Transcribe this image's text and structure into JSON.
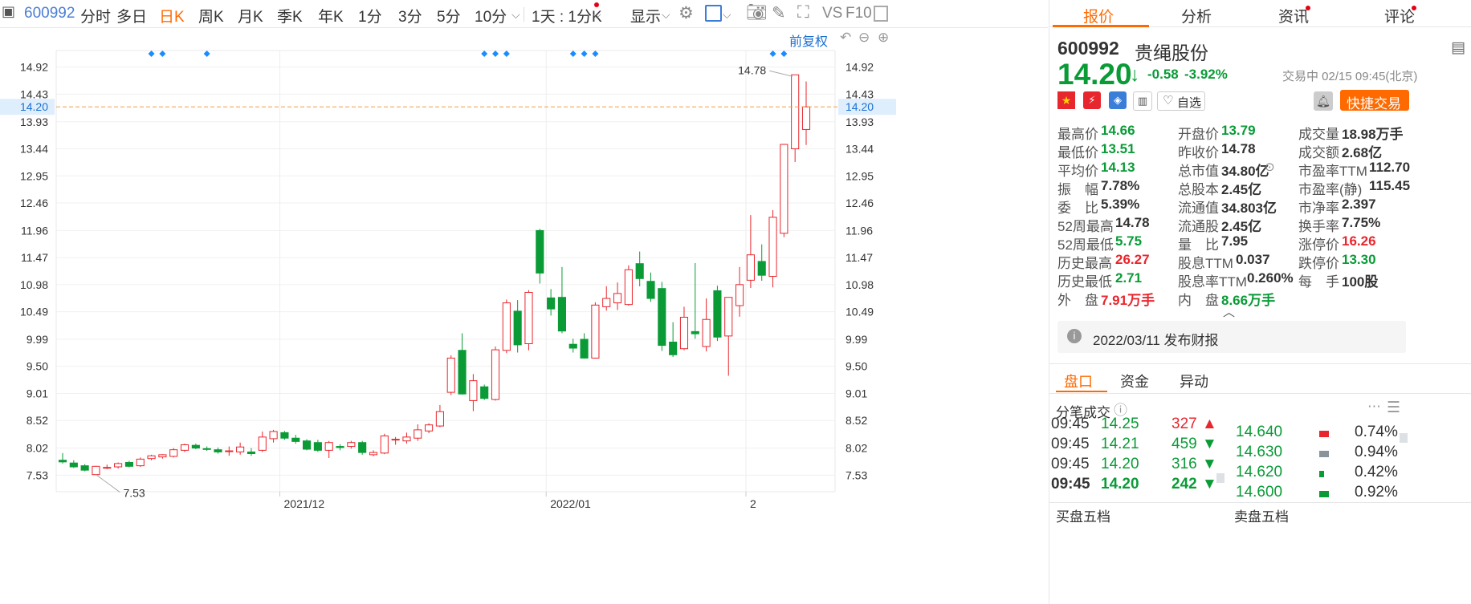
{
  "toolbar": {
    "code": "600992",
    "tabs": [
      "分时",
      "多日",
      "日K",
      "周K",
      "月K",
      "季K",
      "年K",
      "1分",
      "3分",
      "5分",
      "10分"
    ],
    "active_tab": "日K",
    "period_select": "1天 : 1分K",
    "display_label": "显示",
    "vs_label": "VS",
    "f10_label": "F10",
    "restore_label": "前复权"
  },
  "chart": {
    "y_ticks": [
      "14.92",
      "14.43",
      "13.93",
      "13.44",
      "12.95",
      "12.46",
      "11.96",
      "11.47",
      "10.98",
      "10.49",
      "9.99",
      "9.50",
      "9.01",
      "8.52",
      "8.02",
      "7.53"
    ],
    "current_price_tag": "14.20",
    "x_labels": [
      "2021/12",
      "2022/01",
      "2"
    ],
    "max_label": "14.78",
    "min_label": "7.53"
  },
  "chart_data": {
    "type": "candlestick",
    "title": "",
    "ylim": [
      7.23,
      15.22
    ],
    "y_tick_values": [
      14.92,
      14.43,
      13.93,
      13.44,
      12.95,
      12.46,
      11.96,
      11.47,
      10.98,
      10.49,
      9.99,
      9.5,
      9.01,
      8.52,
      8.02,
      7.53
    ],
    "current_price": 14.2,
    "candles": [
      {
        "o": 7.8,
        "h": 7.93,
        "l": 7.74,
        "c": 7.77
      },
      {
        "o": 7.75,
        "h": 7.8,
        "l": 7.66,
        "c": 7.68
      },
      {
        "o": 7.7,
        "h": 7.73,
        "l": 7.6,
        "c": 7.62
      },
      {
        "o": 7.54,
        "h": 7.7,
        "l": 7.53,
        "c": 7.69
      },
      {
        "o": 7.66,
        "h": 7.72,
        "l": 7.64,
        "c": 7.67
      },
      {
        "o": 7.68,
        "h": 7.76,
        "l": 7.65,
        "c": 7.74
      },
      {
        "o": 7.76,
        "h": 7.79,
        "l": 7.67,
        "c": 7.69
      },
      {
        "o": 7.7,
        "h": 7.85,
        "l": 7.68,
        "c": 7.82
      },
      {
        "o": 7.83,
        "h": 7.9,
        "l": 7.8,
        "c": 7.88
      },
      {
        "o": 7.86,
        "h": 7.91,
        "l": 7.83,
        "c": 7.9
      },
      {
        "o": 7.87,
        "h": 8.02,
        "l": 7.85,
        "c": 7.99
      },
      {
        "o": 7.98,
        "h": 8.1,
        "l": 7.95,
        "c": 8.08
      },
      {
        "o": 8.07,
        "h": 8.1,
        "l": 8.0,
        "c": 8.02
      },
      {
        "o": 8.01,
        "h": 8.05,
        "l": 7.97,
        "c": 8.0
      },
      {
        "o": 7.99,
        "h": 8.03,
        "l": 7.92,
        "c": 7.95
      },
      {
        "o": 7.96,
        "h": 8.05,
        "l": 7.88,
        "c": 7.97
      },
      {
        "o": 7.95,
        "h": 8.12,
        "l": 7.9,
        "c": 8.04
      },
      {
        "o": 7.95,
        "h": 8.02,
        "l": 7.88,
        "c": 7.92
      },
      {
        "o": 7.98,
        "h": 8.32,
        "l": 7.95,
        "c": 8.22
      },
      {
        "o": 8.19,
        "h": 8.35,
        "l": 8.12,
        "c": 8.32
      },
      {
        "o": 8.3,
        "h": 8.33,
        "l": 8.17,
        "c": 8.2
      },
      {
        "o": 8.2,
        "h": 8.26,
        "l": 8.1,
        "c": 8.14
      },
      {
        "o": 8.15,
        "h": 8.18,
        "l": 7.98,
        "c": 8.0
      },
      {
        "o": 8.12,
        "h": 8.17,
        "l": 7.95,
        "c": 7.98
      },
      {
        "o": 7.98,
        "h": 8.15,
        "l": 7.84,
        "c": 8.12
      },
      {
        "o": 8.05,
        "h": 8.09,
        "l": 7.98,
        "c": 8.03
      },
      {
        "o": 8.05,
        "h": 8.15,
        "l": 8.01,
        "c": 8.12
      },
      {
        "o": 8.12,
        "h": 8.15,
        "l": 7.9,
        "c": 7.94
      },
      {
        "o": 7.9,
        "h": 7.98,
        "l": 7.87,
        "c": 7.94
      },
      {
        "o": 7.93,
        "h": 8.28,
        "l": 7.91,
        "c": 8.24
      },
      {
        "o": 8.18,
        "h": 8.22,
        "l": 8.08,
        "c": 8.18
      },
      {
        "o": 8.15,
        "h": 8.3,
        "l": 8.1,
        "c": 8.22
      },
      {
        "o": 8.2,
        "h": 8.45,
        "l": 8.15,
        "c": 8.35
      },
      {
        "o": 8.33,
        "h": 8.47,
        "l": 8.29,
        "c": 8.44
      },
      {
        "o": 8.42,
        "h": 8.8,
        "l": 8.4,
        "c": 8.68
      },
      {
        "o": 9.03,
        "h": 9.7,
        "l": 8.98,
        "c": 9.65
      },
      {
        "o": 9.79,
        "h": 10.1,
        "l": 8.99,
        "c": 9.0
      },
      {
        "o": 8.88,
        "h": 9.36,
        "l": 8.69,
        "c": 9.24
      },
      {
        "o": 9.13,
        "h": 9.17,
        "l": 8.89,
        "c": 8.92
      },
      {
        "o": 8.9,
        "h": 9.86,
        "l": 8.88,
        "c": 9.8
      },
      {
        "o": 9.79,
        "h": 10.71,
        "l": 9.74,
        "c": 10.65
      },
      {
        "o": 10.5,
        "h": 10.7,
        "l": 9.75,
        "c": 9.89
      },
      {
        "o": 9.91,
        "h": 10.88,
        "l": 9.79,
        "c": 10.84
      },
      {
        "o": 11.96,
        "h": 11.99,
        "l": 11.0,
        "c": 11.19
      },
      {
        "o": 10.74,
        "h": 10.9,
        "l": 10.42,
        "c": 10.54
      },
      {
        "o": 10.75,
        "h": 11.3,
        "l": 10.1,
        "c": 10.14
      },
      {
        "o": 9.9,
        "h": 10.0,
        "l": 9.75,
        "c": 9.83
      },
      {
        "o": 9.99,
        "h": 10.1,
        "l": 9.64,
        "c": 9.65
      },
      {
        "o": 9.65,
        "h": 10.66,
        "l": 9.64,
        "c": 10.61
      },
      {
        "o": 10.58,
        "h": 10.95,
        "l": 10.51,
        "c": 10.73
      },
      {
        "o": 10.65,
        "h": 11.02,
        "l": 10.52,
        "c": 10.82
      },
      {
        "o": 10.62,
        "h": 11.33,
        "l": 10.6,
        "c": 11.25
      },
      {
        "o": 11.36,
        "h": 11.58,
        "l": 10.95,
        "c": 11.09
      },
      {
        "o": 11.04,
        "h": 11.2,
        "l": 10.67,
        "c": 10.73
      },
      {
        "o": 10.91,
        "h": 11.03,
        "l": 9.78,
        "c": 9.88
      },
      {
        "o": 9.94,
        "h": 10.3,
        "l": 9.67,
        "c": 9.71
      },
      {
        "o": 9.82,
        "h": 10.58,
        "l": 9.79,
        "c": 10.39
      },
      {
        "o": 10.13,
        "h": 11.37,
        "l": 10.0,
        "c": 10.09
      },
      {
        "o": 9.86,
        "h": 10.73,
        "l": 9.77,
        "c": 10.35
      },
      {
        "o": 10.87,
        "h": 10.96,
        "l": 9.96,
        "c": 10.03
      },
      {
        "o": 10.05,
        "h": 10.3,
        "l": 9.33,
        "c": 10.75
      },
      {
        "o": 10.6,
        "h": 11.3,
        "l": 10.4,
        "c": 10.98
      },
      {
        "o": 11.06,
        "h": 12.24,
        "l": 10.92,
        "c": 11.52
      },
      {
        "o": 11.4,
        "h": 11.71,
        "l": 11.05,
        "c": 11.15
      },
      {
        "o": 11.13,
        "h": 12.33,
        "l": 10.93,
        "c": 12.2
      },
      {
        "o": 11.91,
        "h": 13.53,
        "l": 11.84,
        "c": 13.52
      },
      {
        "o": 13.44,
        "h": 14.78,
        "l": 13.2,
        "c": 14.78
      },
      {
        "o": 13.79,
        "h": 14.66,
        "l": 13.51,
        "c": 14.2
      }
    ]
  },
  "quote": {
    "code": "600992",
    "name": "贵绳股份",
    "price": "14.20",
    "arrow": "↓",
    "change": "-0.58",
    "change_pct": "-3.92%",
    "status": "交易中 02/15 09:45(北京)",
    "watch_label": "自选",
    "trade_label": "快捷交易",
    "fields": [
      [
        {
          "k": "最高价",
          "v": "14.66",
          "c": "down"
        },
        {
          "k": "开盘价",
          "v": "13.79",
          "c": "down"
        },
        {
          "k": "成交量",
          "v": "18.98万手",
          "c": ""
        }
      ],
      [
        {
          "k": "最低价",
          "v": "13.51",
          "c": "down"
        },
        {
          "k": "昨收价",
          "v": "14.78",
          "c": ""
        },
        {
          "k": "成交额",
          "v": "2.68亿",
          "c": ""
        }
      ],
      [
        {
          "k": "平均价",
          "v": "14.13",
          "c": "down"
        },
        {
          "k": "总市值",
          "v": "34.80亿",
          "c": ""
        },
        {
          "k": "市盈率TTM",
          "v": "112.70",
          "c": ""
        }
      ],
      [
        {
          "k": "振　幅",
          "v": "7.78%",
          "c": ""
        },
        {
          "k": "总股本",
          "v": "2.45亿",
          "c": ""
        },
        {
          "k": "市盈率(静)",
          "v": "115.45",
          "c": ""
        }
      ],
      [
        {
          "k": "委　比",
          "v": "5.39%",
          "c": ""
        },
        {
          "k": "流通值",
          "v": "34.803亿",
          "c": ""
        },
        {
          "k": "市净率",
          "v": "2.397",
          "c": ""
        }
      ],
      [
        {
          "k": "52周最高",
          "v": "14.78",
          "c": ""
        },
        {
          "k": "流通股",
          "v": "2.45亿",
          "c": ""
        },
        {
          "k": "换手率",
          "v": "7.75%",
          "c": ""
        }
      ],
      [
        {
          "k": "52周最低",
          "v": "5.75",
          "c": "down"
        },
        {
          "k": "量　比",
          "v": "7.95",
          "c": ""
        },
        {
          "k": "涨停价",
          "v": "16.26",
          "c": "up"
        }
      ],
      [
        {
          "k": "历史最高",
          "v": "26.27",
          "c": "up"
        },
        {
          "k": "股息TTM",
          "v": "0.037",
          "c": ""
        },
        {
          "k": "跌停价",
          "v": "13.30",
          "c": "down"
        }
      ],
      [
        {
          "k": "历史最低",
          "v": "2.71",
          "c": "down"
        },
        {
          "k": "股息率TTM",
          "v": "0.260%",
          "c": ""
        },
        {
          "k": "每　手",
          "v": "100股",
          "c": ""
        }
      ],
      [
        {
          "k": "外　盘",
          "v": "7.91万手",
          "c": "up"
        },
        {
          "k": "内　盘",
          "v": "8.66万手",
          "c": "down"
        }
      ]
    ],
    "report_text": "2022/03/11  发布财报"
  },
  "right_tabs": [
    "报价",
    "分析",
    "资讯",
    "评论"
  ],
  "sub_tabs": [
    "盘口",
    "资金",
    "异动"
  ],
  "ticks_title": "分笔成交",
  "ticks": [
    {
      "time": "09:45",
      "price": "14.25",
      "vol": "327",
      "dir": "up"
    },
    {
      "time": "09:45",
      "price": "14.21",
      "vol": "459",
      "dir": "down"
    },
    {
      "time": "09:45",
      "price": "14.20",
      "vol": "316",
      "dir": "down"
    },
    {
      "time": "09:45",
      "price": "14.20",
      "vol": "242",
      "dir": "down"
    }
  ],
  "dist": [
    {
      "price": "14.640",
      "pct": "0.74%",
      "color": "#e8262d"
    },
    {
      "price": "14.630",
      "pct": "0.94%",
      "color": "#8a929a"
    },
    {
      "price": "14.620",
      "pct": "0.42%",
      "color": "#0a9b37"
    },
    {
      "price": "14.600",
      "pct": "0.92%",
      "color": "#0a9b37"
    }
  ],
  "bottom_labels": [
    "买盘五档",
    "卖盘五档"
  ],
  "colors": {
    "up": "#e8262d",
    "down": "#0a9b37",
    "accent": "#ff6a00",
    "link": "#1a6fd1"
  }
}
